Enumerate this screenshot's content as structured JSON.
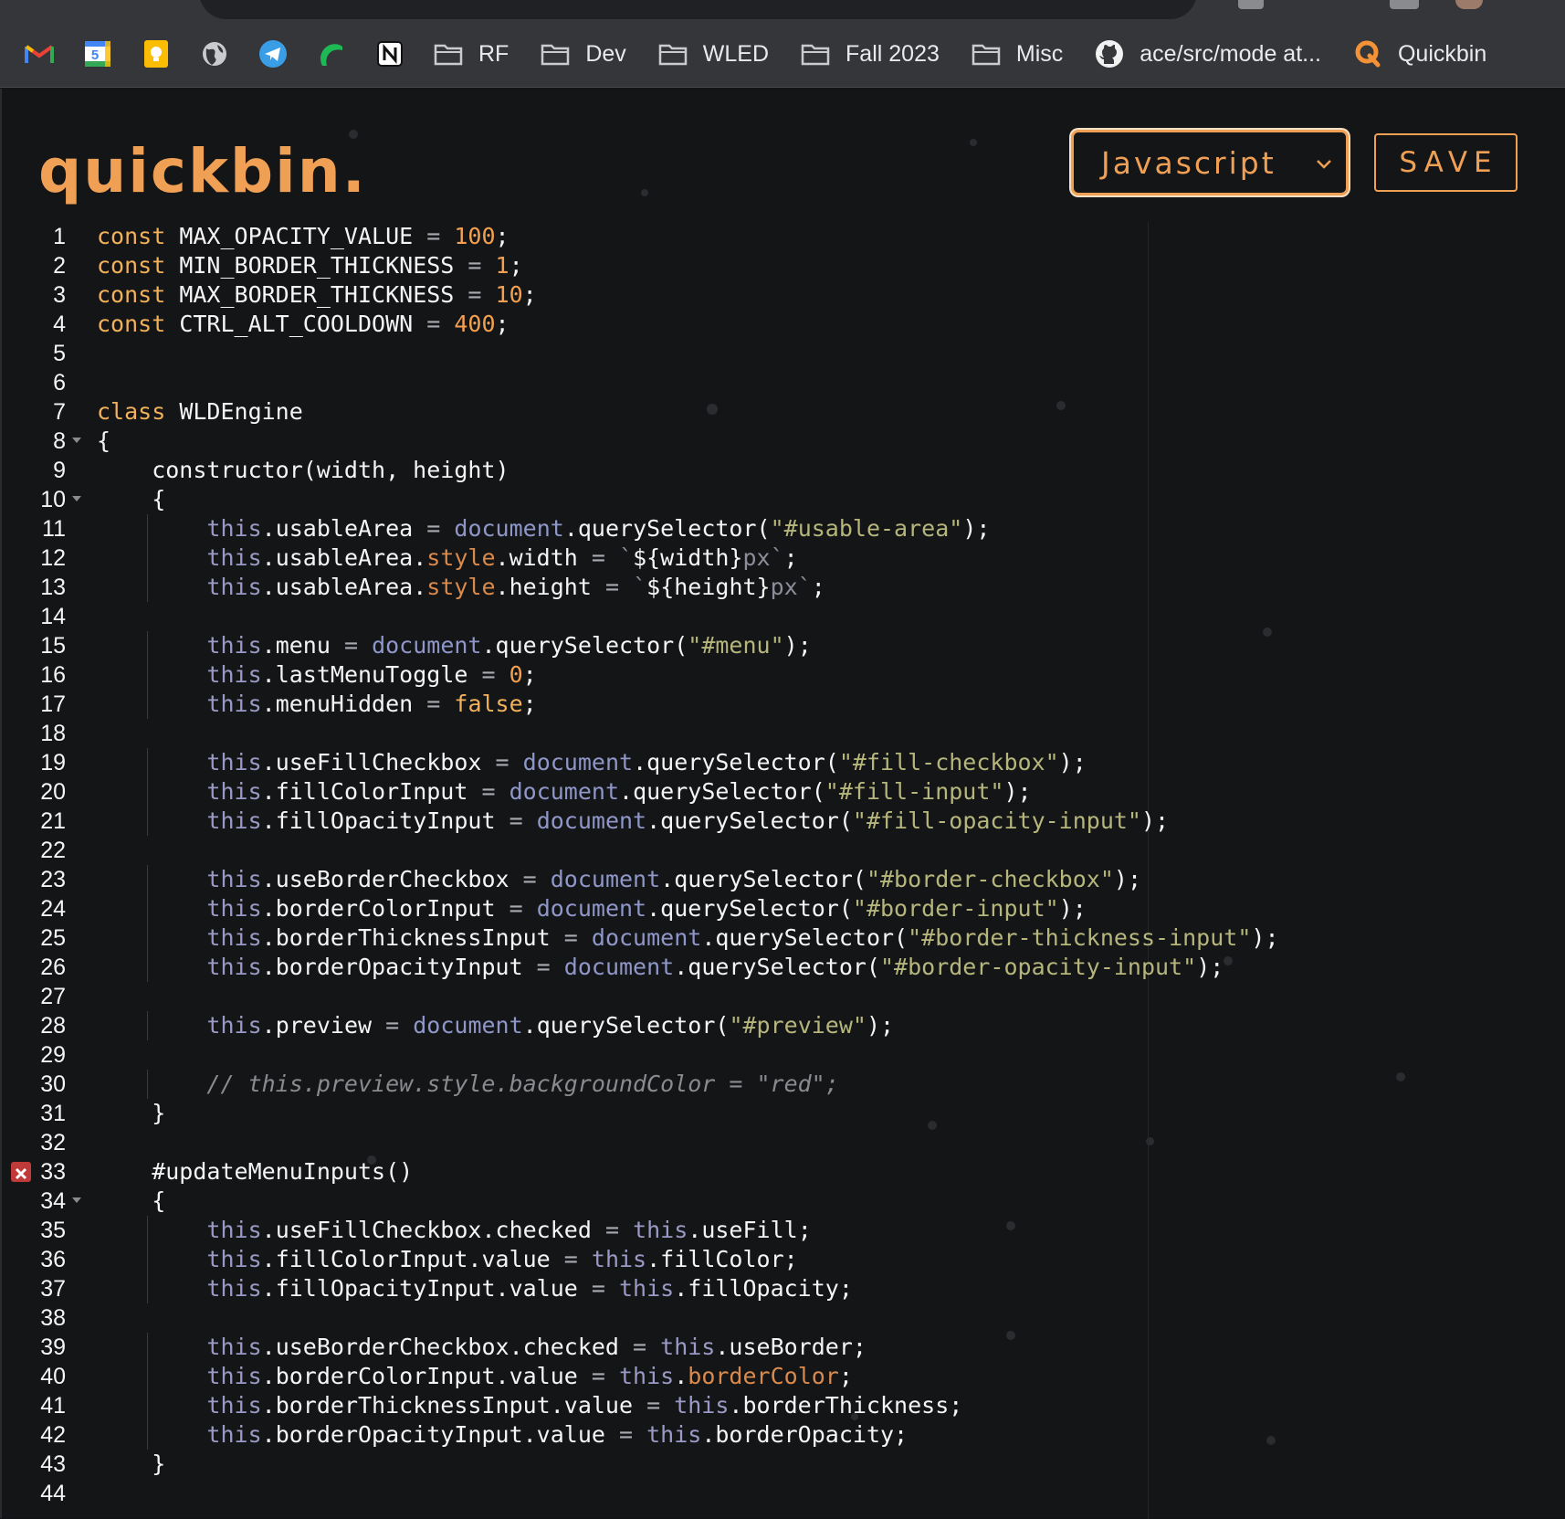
{
  "bookmarks": [
    {
      "icon": "gmail-icon",
      "label": ""
    },
    {
      "icon": "calendar-icon",
      "label": ""
    },
    {
      "icon": "keep-icon",
      "label": ""
    },
    {
      "icon": "globe-icon",
      "label": ""
    },
    {
      "icon": "telegram-icon",
      "label": ""
    },
    {
      "icon": "crescent-icon",
      "label": ""
    },
    {
      "icon": "notion-icon",
      "label": ""
    },
    {
      "icon": "folder-icon",
      "label": "RF"
    },
    {
      "icon": "folder-icon",
      "label": "Dev"
    },
    {
      "icon": "folder-icon",
      "label": "WLED"
    },
    {
      "icon": "folder-icon",
      "label": "Fall 2023"
    },
    {
      "icon": "folder-icon",
      "label": "Misc"
    },
    {
      "icon": "github-icon",
      "label": "ace/src/mode at..."
    },
    {
      "icon": "quickbin-icon",
      "label": "Quickbin"
    }
  ],
  "app": {
    "brand": "quickbin.",
    "language_selected": "Javascript",
    "save_label": "SAVE",
    "accent_color": "#f0a054"
  },
  "editor": {
    "error_line": 33,
    "fold_lines": [
      8,
      10,
      34
    ],
    "lines": [
      {
        "n": "1",
        "code": "const MAX_OPACITY_VALUE = 100;"
      },
      {
        "n": "2",
        "code": "const MIN_BORDER_THICKNESS = 1;"
      },
      {
        "n": "3",
        "code": "const MAX_BORDER_THICKNESS = 10;"
      },
      {
        "n": "4",
        "code": "const CTRL_ALT_COOLDOWN = 400;"
      },
      {
        "n": "5",
        "code": ""
      },
      {
        "n": "6",
        "code": ""
      },
      {
        "n": "7",
        "code": "class WLDEngine"
      },
      {
        "n": "8",
        "code": "{"
      },
      {
        "n": "9",
        "code": "    constructor(width, height)"
      },
      {
        "n": "10",
        "code": "    {"
      },
      {
        "n": "11",
        "code": "        this.usableArea = document.querySelector(\"#usable-area\");"
      },
      {
        "n": "12",
        "code": "        this.usableArea.style.width = `${width}px`;"
      },
      {
        "n": "13",
        "code": "        this.usableArea.style.height = `${height}px`;"
      },
      {
        "n": "14",
        "code": ""
      },
      {
        "n": "15",
        "code": "        this.menu = document.querySelector(\"#menu\");"
      },
      {
        "n": "16",
        "code": "        this.lastMenuToggle = 0;"
      },
      {
        "n": "17",
        "code": "        this.menuHidden = false;"
      },
      {
        "n": "18",
        "code": ""
      },
      {
        "n": "19",
        "code": "        this.useFillCheckbox = document.querySelector(\"#fill-checkbox\");"
      },
      {
        "n": "20",
        "code": "        this.fillColorInput = document.querySelector(\"#fill-input\");"
      },
      {
        "n": "21",
        "code": "        this.fillOpacityInput = document.querySelector(\"#fill-opacity-input\");"
      },
      {
        "n": "22",
        "code": ""
      },
      {
        "n": "23",
        "code": "        this.useBorderCheckbox = document.querySelector(\"#border-checkbox\");"
      },
      {
        "n": "24",
        "code": "        this.borderColorInput = document.querySelector(\"#border-input\");"
      },
      {
        "n": "25",
        "code": "        this.borderThicknessInput = document.querySelector(\"#border-thickness-input\");"
      },
      {
        "n": "26",
        "code": "        this.borderOpacityInput = document.querySelector(\"#border-opacity-input\");"
      },
      {
        "n": "27",
        "code": ""
      },
      {
        "n": "28",
        "code": "        this.preview = document.querySelector(\"#preview\");"
      },
      {
        "n": "29",
        "code": ""
      },
      {
        "n": "30",
        "code": "        // this.preview.style.backgroundColor = \"red\";"
      },
      {
        "n": "31",
        "code": "    }"
      },
      {
        "n": "32",
        "code": ""
      },
      {
        "n": "33",
        "code": "    #updateMenuInputs()"
      },
      {
        "n": "34",
        "code": "    {"
      },
      {
        "n": "35",
        "code": "        this.useFillCheckbox.checked = this.useFill;"
      },
      {
        "n": "36",
        "code": "        this.fillColorInput.value = this.fillColor;"
      },
      {
        "n": "37",
        "code": "        this.fillOpacityInput.value = this.fillOpacity;"
      },
      {
        "n": "38",
        "code": ""
      },
      {
        "n": "39",
        "code": "        this.useBorderCheckbox.checked = this.useBorder;"
      },
      {
        "n": "40",
        "code": "        this.borderColorInput.value = this.borderColor;"
      },
      {
        "n": "41",
        "code": "        this.borderThicknessInput.value = this.borderThickness;"
      },
      {
        "n": "42",
        "code": "        this.borderOpacityInput.value = this.borderOpacity;"
      },
      {
        "n": "43",
        "code": "    }"
      },
      {
        "n": "44",
        "code": ""
      }
    ]
  }
}
